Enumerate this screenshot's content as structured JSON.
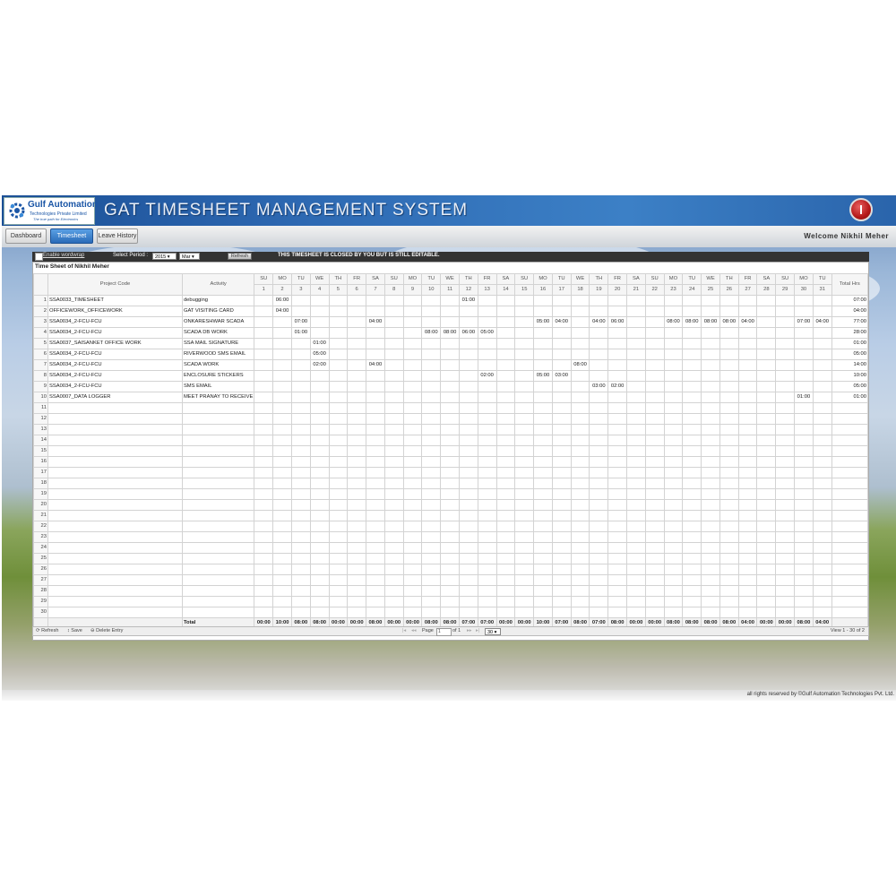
{
  "header": {
    "logo_name": "Gulf Automation",
    "logo_sub": "Technologies Private Limited",
    "logo_tag": "The true path for Electronics",
    "app_title": "GAT TIMESHEET MANAGEMENT SYSTEM"
  },
  "nav": {
    "tabs": [
      {
        "label": "Dashboard"
      },
      {
        "label": "Timesheet"
      },
      {
        "label": "Leave History"
      }
    ],
    "welcome": "Welcome  Nikhil Meher"
  },
  "toolbar": {
    "wordwrap_label": "Enable wordwrap",
    "period_label": "Select Period :",
    "year_value": "2015",
    "month_value": "Mar",
    "refresh_label": "Refresh",
    "closed_message": "THIS TIMESHEET IS CLOSED BY YOU BUT IS STILL EDITABLE."
  },
  "grid": {
    "caption": "Time Sheet of Nikhil Meher",
    "col_project": "Project Code",
    "col_activity": "Activity",
    "col_total": "Total Hrs",
    "days": [
      "SU",
      "MO",
      "TU",
      "WE",
      "TH",
      "FR",
      "SA",
      "SU",
      "MO",
      "TU",
      "WE",
      "TH",
      "FR",
      "SA",
      "SU",
      "MO",
      "TU",
      "WE",
      "TH",
      "FR",
      "SA",
      "SU",
      "MO",
      "TU",
      "WE",
      "TH",
      "FR",
      "SA",
      "SU",
      "MO",
      "TU"
    ],
    "dates": [
      "1",
      "2",
      "3",
      "4",
      "5",
      "6",
      "7",
      "8",
      "9",
      "10",
      "11",
      "12",
      "13",
      "14",
      "15",
      "16",
      "17",
      "18",
      "19",
      "20",
      "21",
      "22",
      "23",
      "24",
      "25",
      "26",
      "27",
      "28",
      "29",
      "30",
      "31"
    ],
    "rows": [
      {
        "n": "1",
        "project": "SSA0033_TIMESHEET",
        "activity": "debugging",
        "total": "07:00",
        "hours": {
          "2": "06:00",
          "12": "01:00"
        }
      },
      {
        "n": "2",
        "project": "OFFICEWORK_OFFICEWORK",
        "activity": "GAT VISITING CARD",
        "total": "04:00",
        "hours": {
          "2": "04:00"
        }
      },
      {
        "n": "3",
        "project": "SSA0034_2-FCU-FCU",
        "activity": "ONKARESHWAR SCADA",
        "total": "77:00",
        "hours": {
          "3": "07:00",
          "7": "04:00",
          "16": "05:00",
          "17": "04:00",
          "19": "04:00",
          "20": "06:00",
          "23": "08:00",
          "24": "08:00",
          "25": "08:00",
          "26": "08:00",
          "27": "04:00",
          "30": "07:00",
          "31": "04:00"
        }
      },
      {
        "n": "4",
        "project": "SSA0034_2-FCU-FCU",
        "activity": "SCADA DB WORK",
        "total": "28:00",
        "hours": {
          "3": "01:00",
          "10": "08:00",
          "11": "08:00",
          "12": "06:00",
          "13": "05:00"
        }
      },
      {
        "n": "5",
        "project": "SSA0037_SAISANKET OFFICE WORK",
        "activity": "SSA MAIL SIGNATURE",
        "total": "01:00",
        "hours": {
          "4": "01:00"
        }
      },
      {
        "n": "6",
        "project": "SSA0034_2-FCU-FCU",
        "activity": "RIVERWOOD SMS EMAIL",
        "total": "05:00",
        "hours": {
          "4": "05:00"
        }
      },
      {
        "n": "7",
        "project": "SSA0034_2-FCU-FCU",
        "activity": "SCADA WORK",
        "total": "14:00",
        "hours": {
          "4": "02:00",
          "7": "04:00",
          "18": "08:00"
        }
      },
      {
        "n": "8",
        "project": "SSA0034_2-FCU-FCU",
        "activity": "ENCLOSURE STICKERS",
        "total": "10:00",
        "hours": {
          "13": "02:00",
          "16": "05:00",
          "17": "03:00"
        }
      },
      {
        "n": "9",
        "project": "SSA0034_2-FCU-FCU",
        "activity": "SMS EMAIL",
        "total": "05:00",
        "hours": {
          "19": "03:00",
          "20": "02:00"
        }
      },
      {
        "n": "10",
        "project": "SSA0007_DATA LOGGER",
        "activity": "MEET PRANAY TO RECEIVE",
        "total": "01:00",
        "hours": {
          "30": "01:00"
        }
      }
    ],
    "empty_row_numbers": [
      "11",
      "12",
      "13",
      "14",
      "15",
      "16",
      "17",
      "18",
      "19",
      "20",
      "21",
      "22",
      "23",
      "24",
      "25",
      "26",
      "27",
      "28",
      "29",
      "30"
    ],
    "total_label": "Total",
    "totals": [
      "00:00",
      "10:00",
      "08:00",
      "08:00",
      "00:00",
      "00:00",
      "08:00",
      "00:00",
      "00:00",
      "08:00",
      "08:00",
      "07:00",
      "07:00",
      "00:00",
      "00:00",
      "10:00",
      "07:00",
      "08:00",
      "07:00",
      "08:00",
      "00:00",
      "00:00",
      "08:00",
      "08:00",
      "08:00",
      "08:00",
      "04:00",
      "00:00",
      "00:00",
      "08:00",
      "04:00"
    ]
  },
  "pager": {
    "refresh": "Refresh",
    "save": "Save",
    "delete": "Delete Entry",
    "page_label": "Page",
    "page_value": "1",
    "of_label": "of 1",
    "per_page": "30",
    "view_label": "View 1 - 30 of 2"
  },
  "footer": {
    "copyright": "all rights reserved by ©Gulf Automation Technologies Pvt. Ltd."
  },
  "colors": {
    "header_blue": "#2e6ab3",
    "active_tab": "#2a6bb8",
    "toolbar_dark": "#333333",
    "power_red": "#b41818"
  }
}
